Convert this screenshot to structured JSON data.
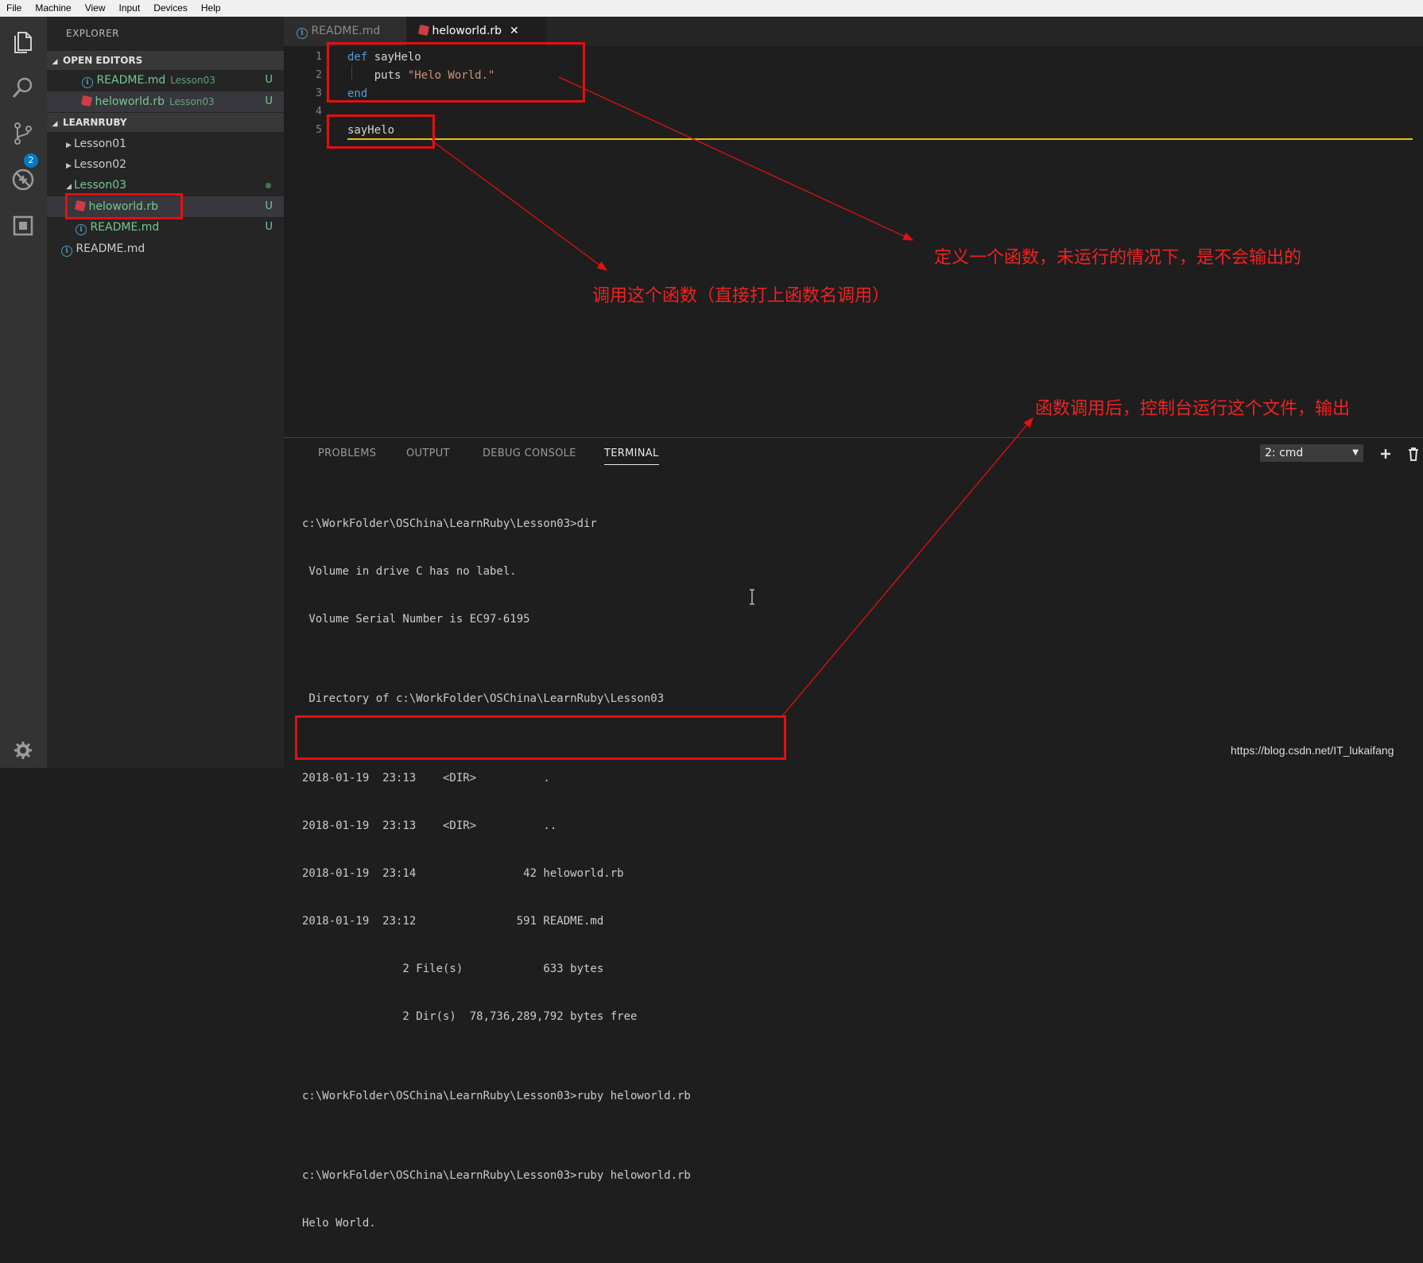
{
  "menu": [
    "File",
    "Machine",
    "View",
    "Input",
    "Devices",
    "Help"
  ],
  "activity_bar": {
    "icons": [
      "files-icon",
      "search-icon",
      "source-control-icon",
      "debug-icon",
      "extensions-icon",
      "settings-gear-icon"
    ],
    "scm_badge": "2"
  },
  "sidebar": {
    "title": "EXPLORER",
    "open_editors": {
      "header": "OPEN EDITORS",
      "items": [
        {
          "name": "README.md",
          "folder": "Lesson03",
          "status": "U"
        },
        {
          "name": "heloworld.rb",
          "folder": "Lesson03",
          "status": "U"
        }
      ]
    },
    "project": {
      "header": "LEARNRUBY",
      "folders": [
        "Lesson01",
        "Lesson02",
        "Lesson03"
      ],
      "lesson03_files": [
        {
          "name": "heloworld.rb",
          "status": "U"
        },
        {
          "name": "README.md",
          "status": "U"
        }
      ],
      "root_file": "README.md"
    }
  },
  "tabs": [
    {
      "label": "README.md",
      "active": false
    },
    {
      "label": "heloworld.rb",
      "active": true,
      "close": "✕"
    }
  ],
  "editor": {
    "line_numbers": [
      "1",
      "2",
      "3",
      "4",
      "5"
    ],
    "lines": {
      "l1_kw": "def",
      "l1_name": " sayHelo",
      "l2_call": "    puts ",
      "l2_str": "\"Helo World.\"",
      "l3_kw": "end",
      "l5": "sayHelo"
    }
  },
  "panel": {
    "tabs": [
      "PROBLEMS",
      "OUTPUT",
      "DEBUG CONSOLE",
      "TERMINAL"
    ],
    "active_tab": "TERMINAL",
    "terminal_select": "2: cmd",
    "terminal_lines": [
      "c:\\WorkFolder\\OSChina\\LearnRuby\\Lesson03>dir",
      " Volume in drive C has no label.",
      " Volume Serial Number is EC97-6195",
      "",
      " Directory of c:\\WorkFolder\\OSChina\\LearnRuby\\Lesson03",
      "",
      "2018-01-19  23:13    <DIR>          .",
      "2018-01-19  23:13    <DIR>          ..",
      "2018-01-19  23:14                42 heloworld.rb",
      "2018-01-19  23:12               591 README.md",
      "               2 File(s)            633 bytes",
      "               2 Dir(s)  78,736,289,792 bytes free",
      "",
      "c:\\WorkFolder\\OSChina\\LearnRuby\\Lesson03>ruby heloworld.rb",
      "",
      "c:\\WorkFolder\\OSChina\\LearnRuby\\Lesson03>ruby heloworld.rb",
      "Helo World."
    ]
  },
  "annotations": {
    "define_note": "定义一个函数，未运行的情况下，是不会输出的",
    "call_note": "调用这个函数（直接打上函数名调用）",
    "output_note": "函数调用后，控制台运行这个文件，输出"
  },
  "watermark": "https://blog.csdn.net/IT_lukaifang",
  "colors": {
    "annotation_red": "#e21010",
    "current_line": "#e5c00c",
    "untracked_green": "#73c991",
    "badge_blue": "#007acc"
  }
}
